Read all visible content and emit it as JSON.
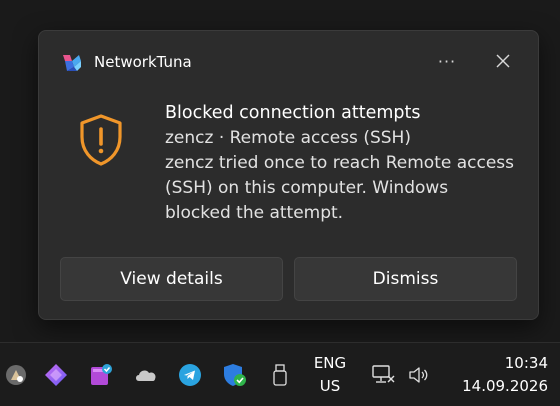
{
  "notification": {
    "app_name": "NetworkTuna",
    "more_label": "···",
    "title": "Blocked connection attempts",
    "subtitle": "zencz · Remote access (SSH)",
    "message": "zencz tried once to reach Remote access (SSH) on this computer. Windows blocked the attempt.",
    "actions": [
      {
        "label": "View details"
      },
      {
        "label": "Dismiss"
      }
    ],
    "accent_color": "#f0962a"
  },
  "taskbar": {
    "tray_icons": [
      "file-explorer-icon",
      "copilot-icon",
      "notebook-icon",
      "onedrive-icon",
      "telegram-icon",
      "windows-security-icon",
      "usb-drive-icon"
    ],
    "language": {
      "line1": "ENG",
      "line2": "US"
    },
    "system_icons": [
      "network-icon",
      "volume-icon"
    ],
    "clock": {
      "time": "10:34",
      "date": "14.09.2026"
    }
  }
}
